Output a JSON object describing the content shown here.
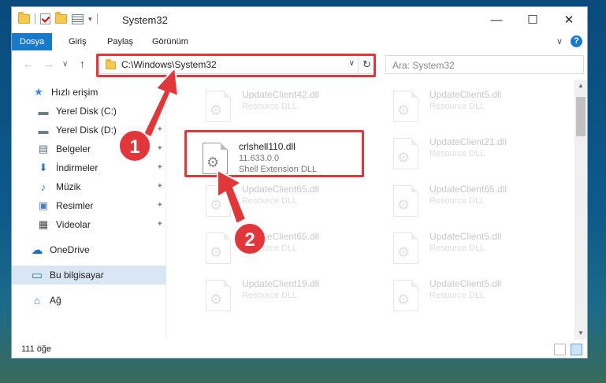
{
  "window": {
    "title": "System32",
    "controls": {
      "minimize": "—",
      "maximize": "☐",
      "close": "✕"
    }
  },
  "ribbon": {
    "tabs": [
      {
        "label": "Dosya",
        "active": true
      },
      {
        "label": "Giriş"
      },
      {
        "label": "Paylaş"
      },
      {
        "label": "Görünüm"
      }
    ],
    "expand_glyph": "∨",
    "help_glyph": "?"
  },
  "nav": {
    "back": "←",
    "forward": "→",
    "recent": "∨",
    "up": "↑",
    "address_path": "C:\\Windows\\System32",
    "address_dropdown": "∨",
    "refresh": "↻",
    "search_placeholder": "Ara: System32"
  },
  "sidebar": {
    "items": [
      {
        "label": "Hızlı erişim",
        "icon": "star-icon",
        "glyph": "★",
        "color": "#3c8ad8"
      },
      {
        "label": "Yerel Disk (C:)",
        "icon": "drive-icon",
        "glyph": "▬",
        "color": "#6d7a86",
        "pinned": true
      },
      {
        "label": "Yerel Disk (D:)",
        "icon": "drive-icon",
        "glyph": "▬",
        "color": "#6d7a86",
        "pinned": true
      },
      {
        "label": "Belgeler",
        "icon": "documents-icon",
        "glyph": "▤",
        "color": "#5a6e82",
        "pinned": true
      },
      {
        "label": "İndirmeler",
        "icon": "downloads-icon",
        "glyph": "⬇",
        "color": "#2b78c2",
        "pinned": true
      },
      {
        "label": "Müzik",
        "icon": "music-icon",
        "glyph": "♪",
        "color": "#2b78c2",
        "pinned": true
      },
      {
        "label": "Resimler",
        "icon": "pictures-icon",
        "glyph": "▣",
        "color": "#4f7fb0",
        "pinned": true
      },
      {
        "label": "Videolar",
        "icon": "videos-icon",
        "glyph": "▦",
        "color": "#444",
        "pinned": true
      },
      {
        "label": "OneDrive",
        "icon": "cloud-icon",
        "glyph": "☁",
        "color": "#1f6fc0"
      },
      {
        "label": "Bu bilgisayar",
        "icon": "computer-icon",
        "glyph": "▭",
        "color": "#2b78c2",
        "selected": true
      },
      {
        "label": "Ağ",
        "icon": "network-icon",
        "glyph": "⌂",
        "color": "#2b78c2"
      }
    ],
    "pin_glyph": "✦"
  },
  "files": [
    {
      "name": "UpdateClient42.dll",
      "type": "Resource DLL"
    },
    {
      "name": "UpdateClient5.dll",
      "type": "Resource DLL"
    },
    {
      "name": "crlshell110.dll",
      "version": "11.633.0.0",
      "type": "Shell Extension DLL",
      "selected": true
    },
    {
      "name": "UpdateClient21.dll",
      "type": "Resource DLL"
    },
    {
      "name": "UpdateClient65.dll",
      "type": "Resource DLL"
    },
    {
      "name": "UpdateClient65.dll",
      "type": "Resource DLL"
    },
    {
      "name": "UpdateClient65.dll",
      "type": "Resource DLL"
    },
    {
      "name": "UpdateClient5.dll",
      "type": "Resource DLL"
    },
    {
      "name": "UpdateClient19.dll",
      "type": "Resource DLL"
    },
    {
      "name": "UpdateClient5.dll",
      "type": "Resource DLL"
    }
  ],
  "status": {
    "item_count": "111 öğe"
  },
  "annotations": [
    {
      "number": "1"
    },
    {
      "number": "2"
    }
  ],
  "colors": {
    "accent": "#1979ca",
    "highlight": "#e0373b"
  }
}
